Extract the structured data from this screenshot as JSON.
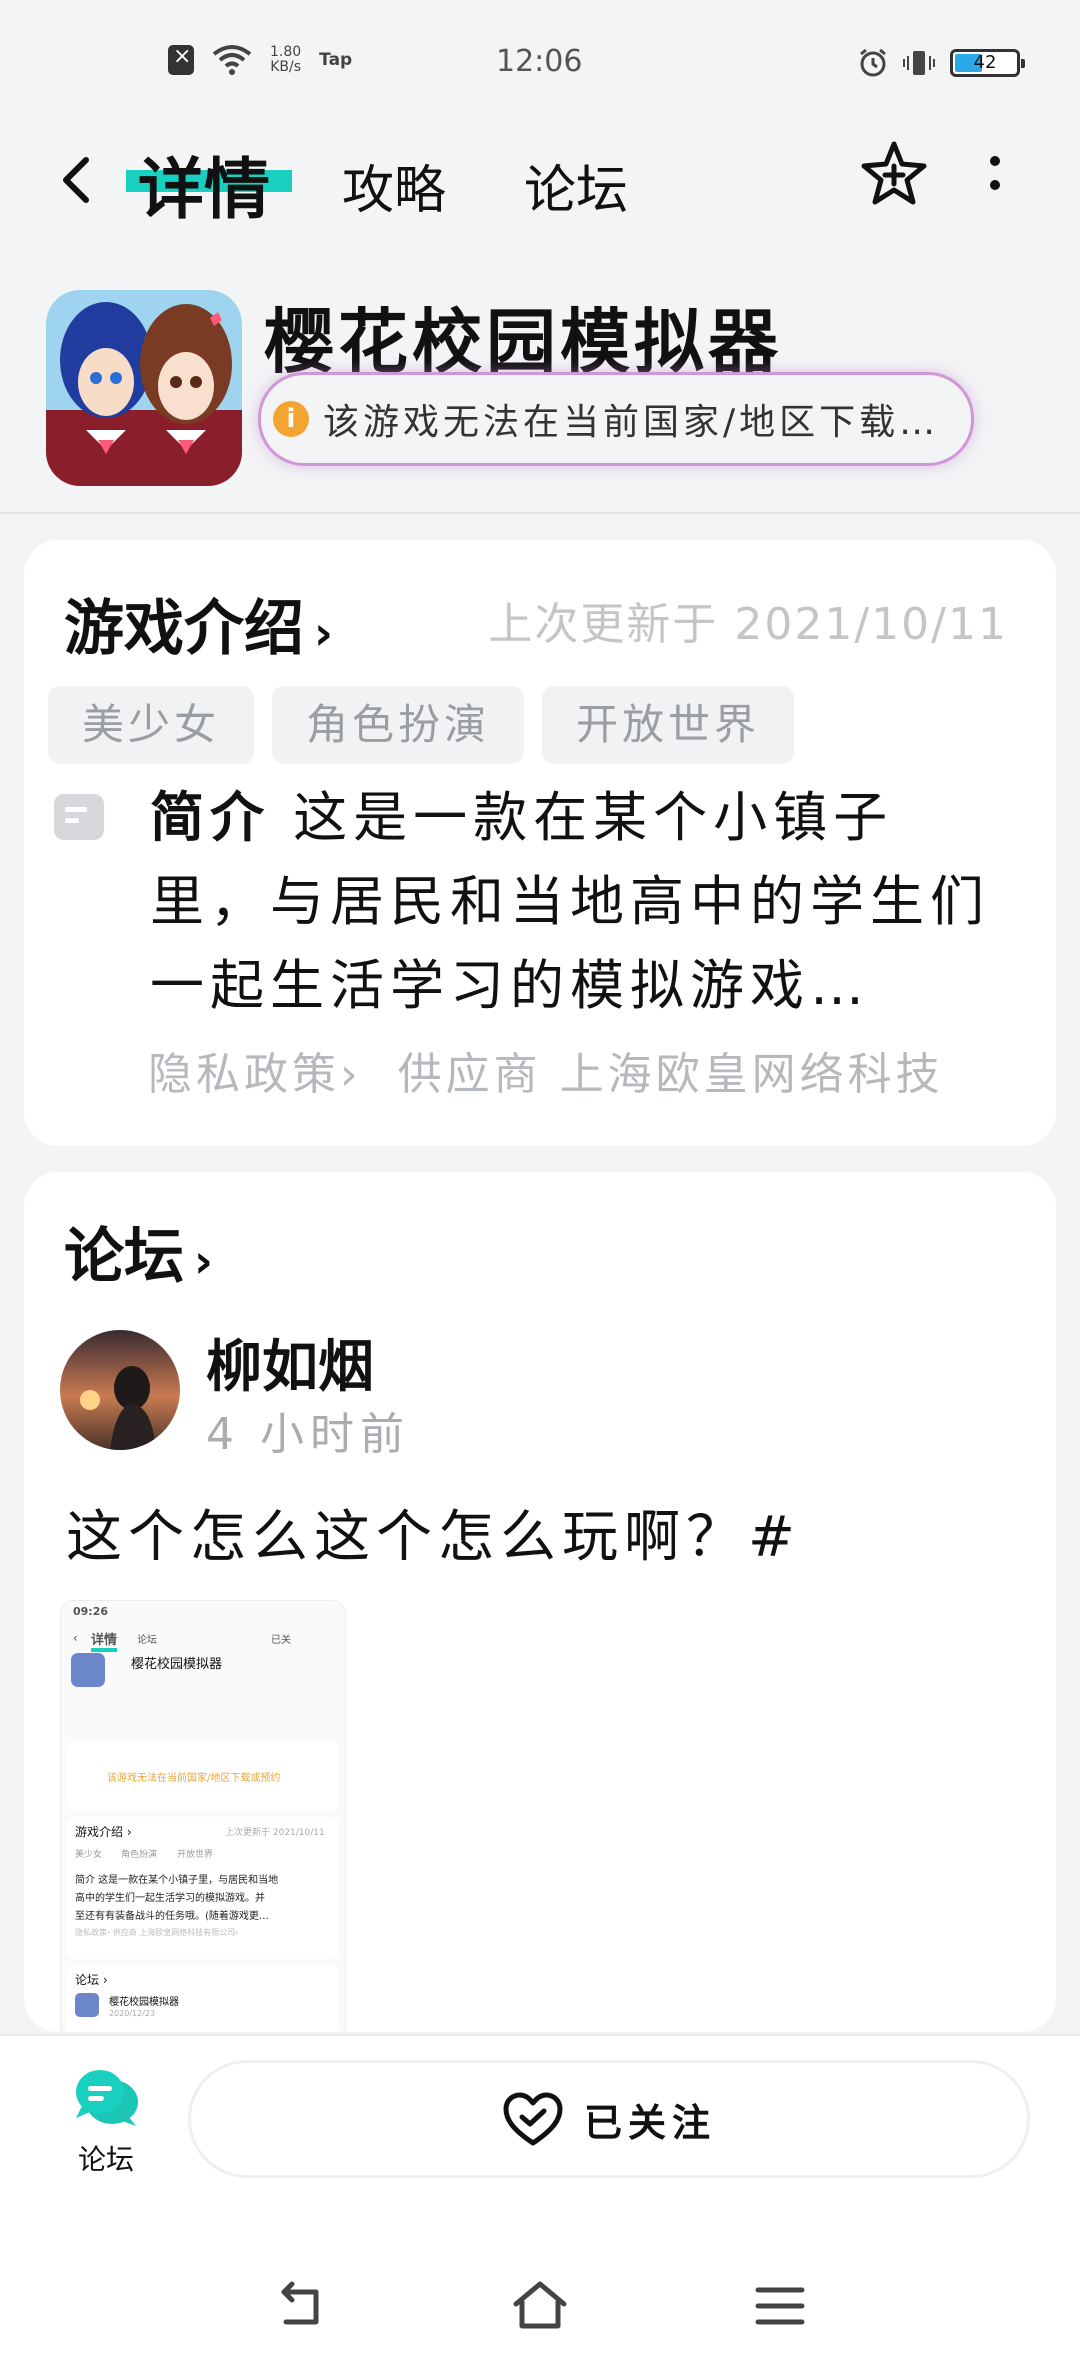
{
  "status_bar": {
    "net_speed_value": "1.80",
    "net_speed_unit": "KB/s",
    "tap_label": "Tap",
    "time": "12:06",
    "battery_level": "42",
    "battery_fraction": 0.42
  },
  "header": {
    "tabs": [
      {
        "label": "详情",
        "active": true
      },
      {
        "label": "攻略",
        "active": false
      },
      {
        "label": "论坛",
        "active": false
      }
    ],
    "accent_color": "#19d0c0"
  },
  "game": {
    "title": "樱花校园模拟器",
    "notice": "该游戏无法在当前国家/地区下载…"
  },
  "intro": {
    "section_title": "游戏介绍",
    "updated": "上次更新于 2021/10/11",
    "tags": [
      "美少女",
      "角色扮演",
      "开放世界"
    ],
    "desc_label": "简介",
    "desc_text": " 这是一款在某个小镇子里，与居民和当地高中的学生们一起生活学习的模拟游戏…",
    "privacy_link": "隐私政策›",
    "provider": "供应商 上海欧皇网络科技"
  },
  "forum": {
    "section_title": "论坛",
    "post": {
      "username": "柳如烟",
      "time": "4 小时前",
      "text": "这个怎么这个怎么玩啊？#",
      "thumbnail": {
        "time": "09:26",
        "tab_active": "详情",
        "tab_forum": "论坛",
        "followed": "已关",
        "game_title": "樱花校园模拟器",
        "notice": "该游戏无法在当前国家/地区下载或预约",
        "intro_title": "游戏介绍 ›",
        "updated": "上次更新于 2021/10/11",
        "tags": [
          "美少女",
          "角色扮演",
          "开放世界"
        ],
        "desc_line1": "简介 这是一款在某个小镇子里，与居民和当地",
        "desc_line2": "高中的学生们一起生活学习的模拟游戏。并",
        "desc_line3": "至还有有装备战斗的任务哦。(随着游戏更…",
        "meta": "隐私政策›   供应商 上海欧皇网络科技有限公司›",
        "forum_title": "论坛 ›",
        "forum_game": "樱花校园模拟器",
        "forum_date": "2020/12/23"
      }
    }
  },
  "bottom": {
    "forum_tab_label": "论坛",
    "follow_label": "已关注"
  },
  "icons": {
    "back": "back-arrow-icon",
    "follow": "star-plus-icon",
    "more": "more-vertical-icon",
    "notice": "info-icon",
    "forum_tab": "chat-bubble-icon",
    "followed": "heart-check-icon",
    "nav_back": "nav-back-icon",
    "nav_home": "nav-home-icon",
    "nav_menu": "nav-menu-icon"
  }
}
